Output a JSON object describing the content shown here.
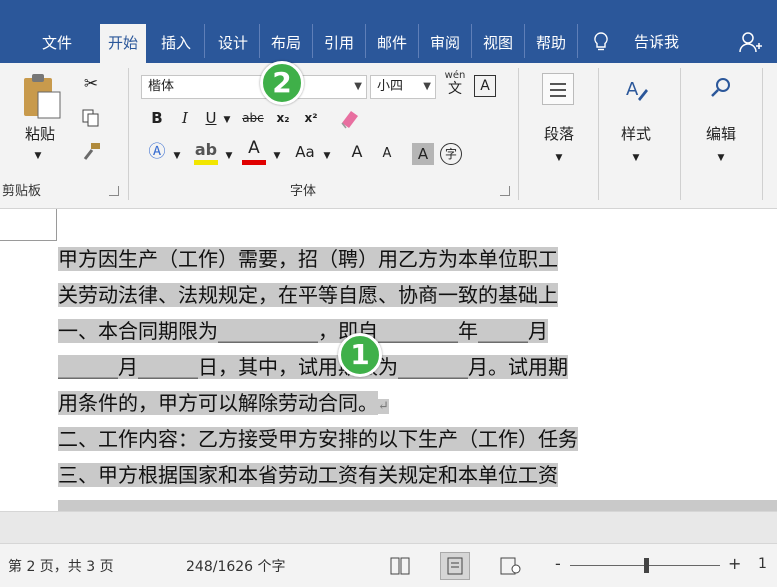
{
  "tabs": [
    {
      "label": "文件",
      "active": false
    },
    {
      "label": "开始",
      "active": true
    },
    {
      "label": "插入",
      "active": false
    },
    {
      "label": "设计",
      "active": false
    },
    {
      "label": "布局",
      "active": false
    },
    {
      "label": "引用",
      "active": false
    },
    {
      "label": "邮件",
      "active": false
    },
    {
      "label": "审阅",
      "active": false
    },
    {
      "label": "视图",
      "active": false
    },
    {
      "label": "帮助",
      "active": false
    }
  ],
  "tell_me": {
    "label": "告诉我",
    "icon": "lightbulb-icon"
  },
  "share_icon": "person-icon",
  "clipboard": {
    "paste_label": "粘贴",
    "group_label": "剪贴板"
  },
  "font": {
    "font_name": "楷体",
    "font_size": "小四",
    "group_label": "字体",
    "bold": "B",
    "italic": "I",
    "underline": "U",
    "strike": "abc",
    "subscript": "x₂",
    "superscript": "x²",
    "wen": "wén",
    "wen_char": "文",
    "boxed_a": "A",
    "aa": "Aa",
    "grow": "A",
    "shrink": "A",
    "shade_a": "A",
    "circle_char": "字"
  },
  "paragraph": {
    "label": "段落"
  },
  "styles": {
    "label": "样式"
  },
  "editing": {
    "label": "编辑"
  },
  "callouts": {
    "one": "1",
    "two": "2"
  },
  "document": {
    "lines": [
      "甲方因生产（工作）需要，招（聘）用乙方为本单位职工",
      "关劳动法律、法规规定，在平等自愿、协商一致的基础上",
      "一、本合同期限为__________，即自________年_____月",
      "______月______日，其中，试用期限为_______月。试用期",
      "用条件的，甲方可以解除劳动合同。",
      "二、工作内容：乙方接受甲方安排的以下生产（工作）任务",
      "三、甲方根据国家和本省劳动工资有关规定和本单位工资"
    ],
    "paragraph_mark": "↵"
  },
  "status": {
    "page": "第 2 页，共 3 页",
    "words": "248/1626 个字",
    "zoom_minus": "-",
    "zoom_plus": "+",
    "zoom_value": "1"
  },
  "colors": {
    "ribbon_blue": "#2b579a",
    "highlight_yellow": "#f2e600",
    "font_red": "#e00000",
    "callout_green": "#3fb049",
    "selection_gray": "#c9c9c9"
  }
}
